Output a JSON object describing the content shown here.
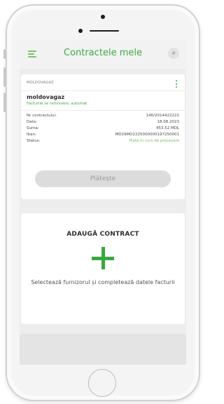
{
  "header": {
    "title": "Contractele mele",
    "menu_icon": "menu-icon",
    "help_icon": "help-icon",
    "help_glyph": "#",
    "accent_color": "#3fa944"
  },
  "contract": {
    "code": "MOLDOVAGAZ",
    "provider": "moldovagaz",
    "note": "Facturile se reînnoiesc automat",
    "rows": [
      {
        "label": "Nr contractului:",
        "value": "146/2014422222"
      },
      {
        "label": "Data:",
        "value": "18.08.2023"
      },
      {
        "label": "Suma:",
        "value": "453.52 MDL"
      },
      {
        "label": "Iban:",
        "value": "MD29MO2225000000197250001"
      },
      {
        "label": "Status:",
        "value": "Plată în curs de procesare"
      }
    ],
    "pay_button": "Plătește",
    "more_icon": "more-vertical-icon"
  },
  "add_contract": {
    "title": "ADAUGĂ CONTRACT",
    "description": "Selectează furnizorul și completează datele facturii",
    "icon": "plus-icon"
  }
}
